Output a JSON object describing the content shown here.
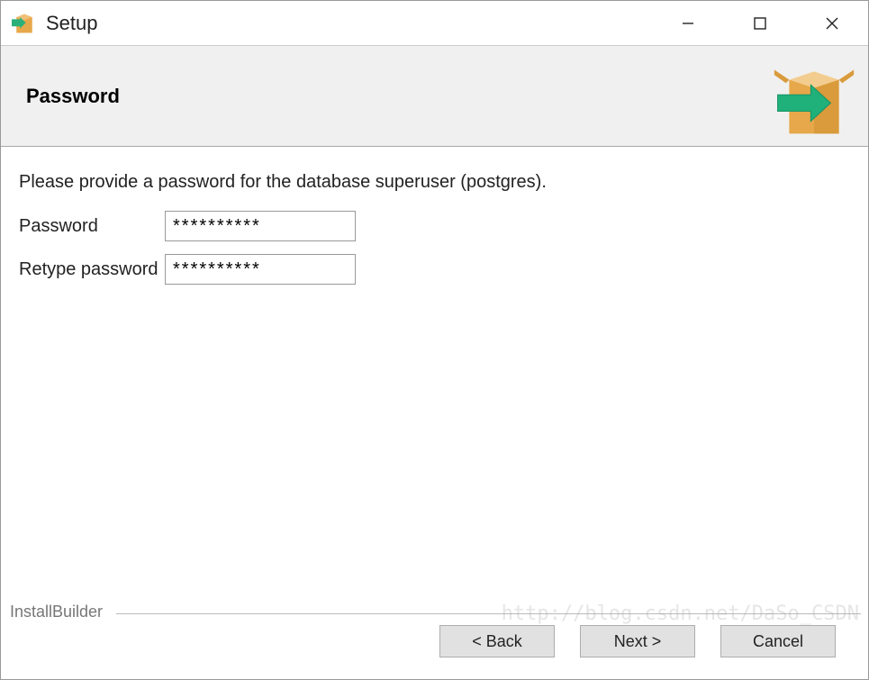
{
  "titlebar": {
    "title": "Setup"
  },
  "header": {
    "title": "Password"
  },
  "content": {
    "instruction": "Please provide a password for the database superuser (postgres).",
    "password_label": "Password",
    "password_value": "**********",
    "retype_label": "Retype password",
    "retype_value": "**********"
  },
  "footer": {
    "brand": "InstallBuilder",
    "back": "< Back",
    "next": "Next >",
    "cancel": "Cancel"
  },
  "watermark": "http://blog.csdn.net/DaSo_CSDN"
}
